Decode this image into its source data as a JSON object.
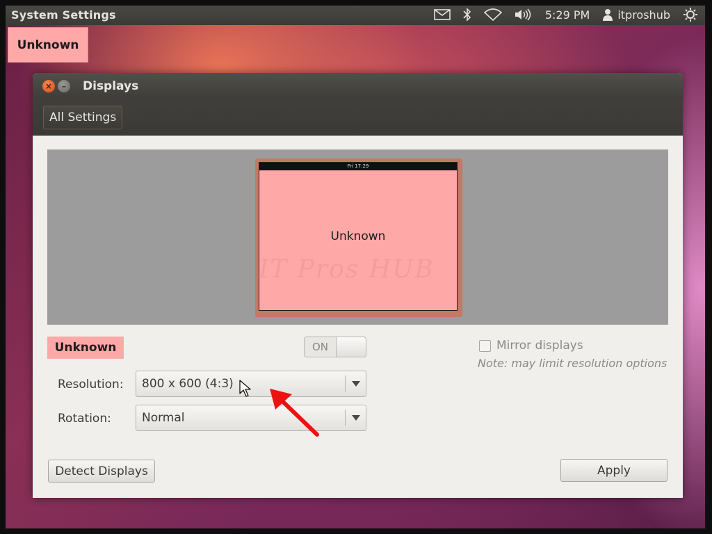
{
  "top_panel": {
    "app_title": "System Settings",
    "clock": "5:29 PM",
    "user": "itproshub",
    "icons": [
      "mail-icon",
      "bluetooth-icon",
      "wifi-icon",
      "volume-icon",
      "user-icon",
      "gear-icon"
    ]
  },
  "desktop": {
    "display_label": "Unknown"
  },
  "window": {
    "title": "Displays",
    "all_settings_label": "All Settings",
    "close_glyph": "×",
    "minimize_glyph": "–"
  },
  "preview": {
    "monitor_clock": "Fri 17:29",
    "monitor_name": "Unknown",
    "monitor_color": "#ffa8a8",
    "watermark": "IT Pros HUB"
  },
  "display_settings": {
    "display_name": "Unknown",
    "power_toggle": {
      "label": "ON",
      "state": "off"
    },
    "mirror": {
      "label": "Mirror displays",
      "checked": false,
      "note": "Note: may limit resolution options"
    },
    "resolution": {
      "label": "Resolution:",
      "value": "800 x 600 (4:3)"
    },
    "rotation": {
      "label": "Rotation:",
      "value": "Normal"
    }
  },
  "buttons": {
    "detect": "Detect Displays",
    "apply": "Apply"
  }
}
